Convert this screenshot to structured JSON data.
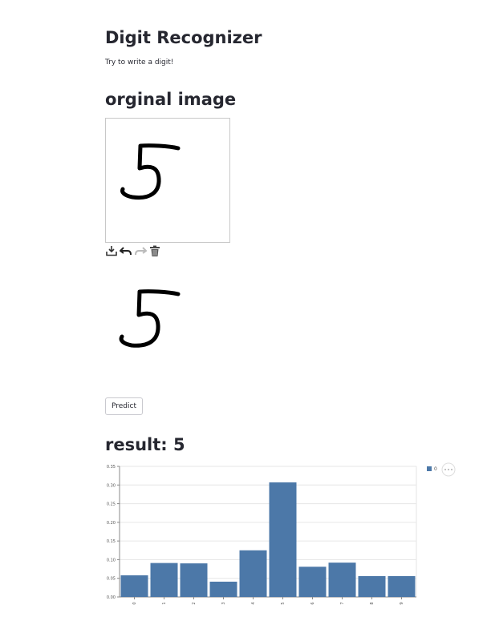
{
  "app": {
    "title": "Digit Recognizer",
    "subtitle": "Try to write a digit!"
  },
  "original": {
    "heading": "orginal image"
  },
  "toolbar": {
    "icons": [
      "download-icon",
      "undo-icon",
      "redo-icon",
      "trash-icon"
    ]
  },
  "predict_label": "Predict",
  "result": {
    "text": "result: 5"
  },
  "colors": {
    "bar": "#4c78a8",
    "grid": "#e6e6e6",
    "axis": "#888888",
    "stroke": "#000000"
  },
  "chart_data": {
    "type": "bar",
    "categories": [
      "0",
      "1",
      "2",
      "3",
      "4",
      "5",
      "6",
      "7",
      "8",
      "9"
    ],
    "series": [
      {
        "name": "0",
        "values": [
          0.058,
          0.091,
          0.09,
          0.041,
          0.125,
          0.307,
          0.081,
          0.092,
          0.056,
          0.056
        ]
      }
    ],
    "ylim": [
      0,
      0.35
    ],
    "yticks": [
      "0.00",
      "0.05",
      "0.10",
      "0.15",
      "0.20",
      "0.25",
      "0.30",
      "0.35"
    ],
    "grid": true,
    "legend": "top-right"
  }
}
